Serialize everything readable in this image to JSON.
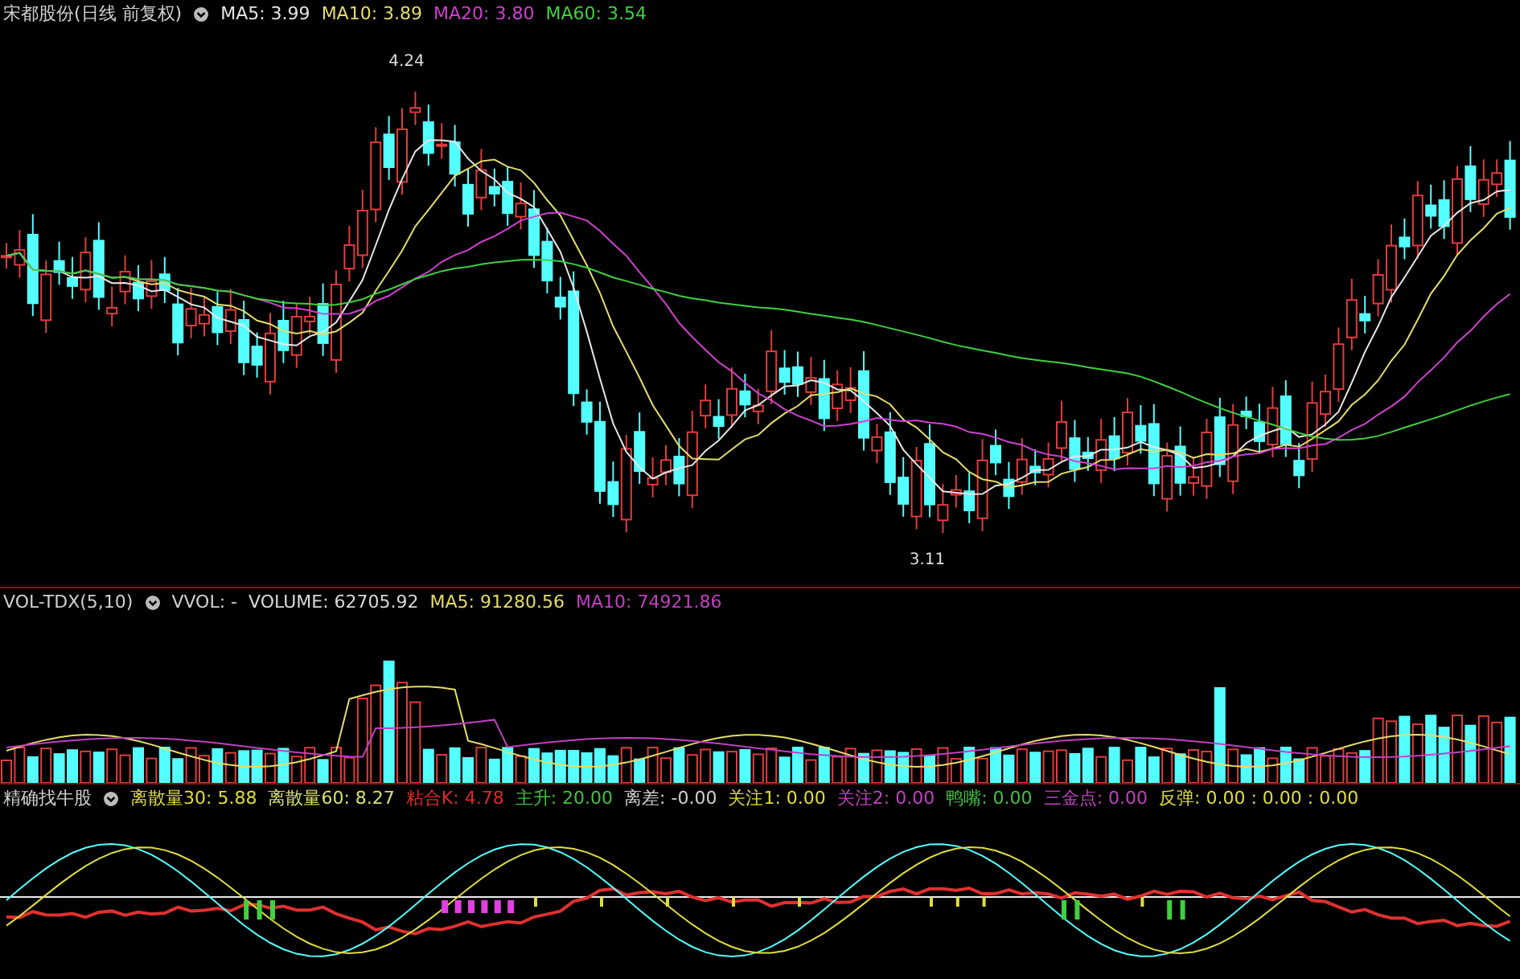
{
  "main_panel": {
    "title": "宋都股份(日线 前复权)",
    "legend": [
      {
        "label": "MA5: 3.99",
        "color": "#e6e6e6"
      },
      {
        "label": "MA10: 3.89",
        "color": "#e4dc6c"
      },
      {
        "label": "MA20: 3.80",
        "color": "#d040d0"
      },
      {
        "label": "MA60: 3.54",
        "color": "#40d040"
      }
    ],
    "high_label": "4.24",
    "low_label": "3.11"
  },
  "volume_panel": {
    "title": "VOL-TDX(5,10)",
    "subtitle": "VVOL: -",
    "legend": [
      {
        "label": "VOLUME: 62705.92",
        "color": "#d8d8d8"
      },
      {
        "label": "MA5: 91280.56",
        "color": "#e4dc6c"
      },
      {
        "label": "MA10: 74921.86",
        "color": "#c040c0"
      }
    ]
  },
  "indicator_panel": {
    "title": "精确找牛股",
    "legend": [
      {
        "label": "离散量30: 5.88",
        "color": "#e0dc40"
      },
      {
        "label": "离散量60: 8.27",
        "color": "#d8e070"
      },
      {
        "label": "粘合K: 4.78",
        "color": "#e02828"
      },
      {
        "label": "主升: 20.00",
        "color": "#40c040"
      },
      {
        "label": "离差: -0.00",
        "color": "#d0d0d0"
      },
      {
        "label": "关注1: 0.00",
        "color": "#e0dc40"
      },
      {
        "label": "关注2: 0.00",
        "color": "#c040c0"
      },
      {
        "label": "鸭嘴: 0.00",
        "color": "#40c040"
      },
      {
        "label": "三金点: 0.00",
        "color": "#c040c0"
      },
      {
        "label": "反弹: 0.00 : 0.00 : 0.00",
        "color": "#e0dc40"
      }
    ]
  }
}
